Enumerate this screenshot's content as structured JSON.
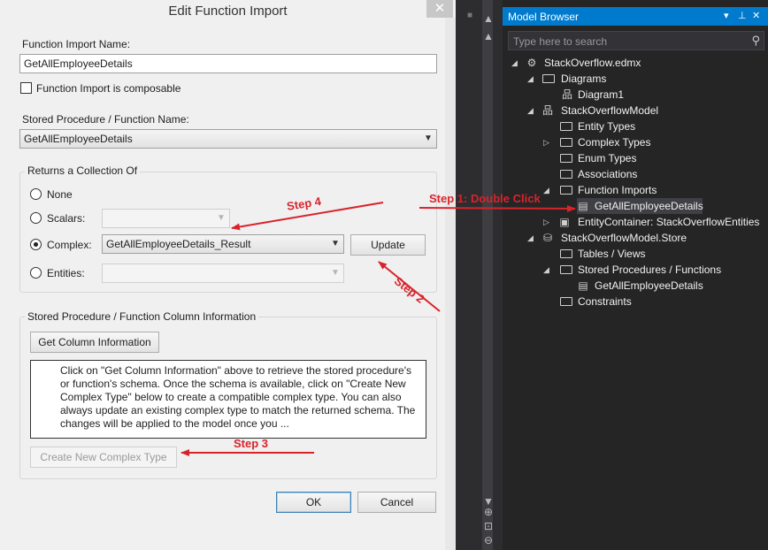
{
  "dialog": {
    "title": "Edit Function Import",
    "close_glyph": "✕",
    "function_import_name_label": "Function Import Name:",
    "function_import_name_value": "GetAllEmployeeDetails",
    "composable_label": "Function Import is composable",
    "composable_checked": false,
    "stored_procedure_label": "Stored Procedure / Function Name:",
    "stored_procedure_value": "GetAllEmployeeDetails",
    "returns_group_label": "Returns a Collection Of",
    "returns_options": {
      "none": "None",
      "scalars": "Scalars:",
      "complex": "Complex:",
      "entities": "Entities:"
    },
    "returns_selected": "complex",
    "scalars_value": "",
    "complex_value": "GetAllEmployeeDetails_Result",
    "entities_value": "",
    "update_button": "Update",
    "column_info_group_label": "Stored Procedure / Function Column Information",
    "get_column_info_button": "Get Column Information",
    "info_text": "Click on \"Get Column Information\" above to retrieve the stored procedure's or function's schema. Once the schema is available, click on \"Create New Complex Type\" below to create a compatible complex type. You can also always update an existing complex type to match the returned schema. The changes will be applied to the model once you ...",
    "create_complex_button": "Create New Complex Type",
    "ok_button": "OK",
    "cancel_button": "Cancel"
  },
  "model_browser": {
    "title": "Model Browser",
    "titlebar_icons": [
      "dropdown-icon",
      "pin-icon",
      "close-icon"
    ],
    "search_placeholder": "Type here to search",
    "tree": [
      {
        "label": "StackOverflow.edmx",
        "icon": "edmx-icon",
        "expanded": true
      },
      {
        "label": "Diagrams",
        "icon": "folder-icon",
        "expanded": true
      },
      {
        "label": "Diagram1",
        "icon": "diagram-icon"
      },
      {
        "label": "StackOverflowModel",
        "icon": "model-icon",
        "expanded": true
      },
      {
        "label": "Entity Types",
        "icon": "folder-icon"
      },
      {
        "label": "Complex Types",
        "icon": "folder-icon",
        "expanded": false
      },
      {
        "label": "Enum Types",
        "icon": "folder-icon"
      },
      {
        "label": "Associations",
        "icon": "folder-icon"
      },
      {
        "label": "Function Imports",
        "icon": "folder-icon",
        "expanded": true
      },
      {
        "label": "GetAllEmployeeDetails",
        "icon": "function-import-icon",
        "selected": true
      },
      {
        "label": "EntityContainer: StackOverflowEntities",
        "icon": "entity-container-icon",
        "expanded": false
      },
      {
        "label": "StackOverflowModel.Store",
        "icon": "database-icon",
        "expanded": true
      },
      {
        "label": "Tables / Views",
        "icon": "folder-icon"
      },
      {
        "label": "Stored Procedures / Functions",
        "icon": "folder-icon",
        "expanded": true
      },
      {
        "label": "GetAllEmployeeDetails",
        "icon": "stored-procedure-icon"
      },
      {
        "label": "Constraints",
        "icon": "folder-icon"
      }
    ]
  },
  "annotations": {
    "step1": "Step 1: Double Click",
    "step2": "Step 2",
    "step3": "Step 3",
    "step4": "Step 4",
    "color": "#d9232b"
  }
}
